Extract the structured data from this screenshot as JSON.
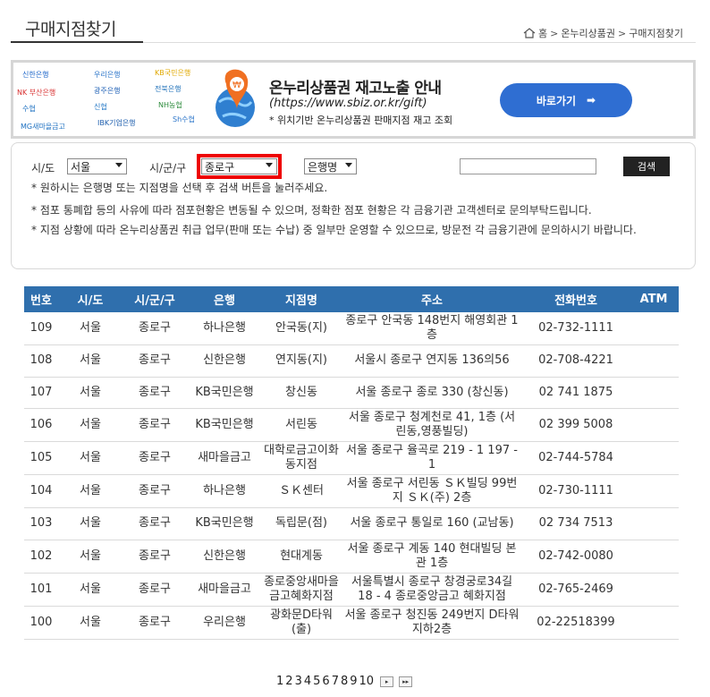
{
  "page": {
    "title": "구매지점찾기"
  },
  "breadcrumb": {
    "home": "홈",
    "level1": "온누리상품권",
    "level2": "구매지점찾기",
    "separator": ">"
  },
  "banner": {
    "title": "온누리상품권 재고노출 안내",
    "url": "(https://www.sbiz.or.kr/gift)",
    "description": "* 위치기반 온누리상품권 판매지점 재고 조회",
    "button_label": "바로가기",
    "button_arrow": "➡",
    "bank_logos": [
      "신한은행",
      "우리은행",
      "KB국민은행",
      "NK 부산은행",
      "광주은행",
      "전북은행",
      "수협",
      "신협",
      "NH농협",
      "MG새마을금고",
      "IBK기업은행",
      "Sh수협"
    ]
  },
  "search": {
    "sido_label": "시/도",
    "sido_value": "서울",
    "sigungu_label": "시/군/구",
    "sigungu_value": "종로구",
    "bank_select_value": "은행명",
    "keyword_value": "",
    "button_label": "검색",
    "notes": [
      "* 원하시는 은행명 또는 지점명을 선택 후 검색 버튼을 눌러주세요.",
      "* 점포 통폐합 등의 사유에 따라 점포현황은 변동될 수 있으며, 정확한 점포 현황은 각 금융기관 고객센터로 문의부탁드립니다.",
      "* 지점 상황에 따라 온누리상품권 취급 업무(판매 또는 수납) 중 일부만 운영할 수 있으므로, 방문전 각 금융기관에 문의하시기 바랍니다."
    ]
  },
  "table": {
    "headers": [
      "번호",
      "시/도",
      "시/군/구",
      "은행",
      "지점명",
      "주소",
      "전화번호",
      "ATM"
    ],
    "rows": [
      [
        "109",
        "서울",
        "종로구",
        "하나은행",
        "안국동(지)",
        "종로구 안국동 148번지 해영회관 1층",
        "02-732-1111",
        ""
      ],
      [
        "108",
        "서울",
        "종로구",
        "신한은행",
        "연지동(지)",
        "서울시 종로구 연지동 136의56",
        "02-708-4221",
        ""
      ],
      [
        "107",
        "서울",
        "종로구",
        "KB국민은행",
        "창신동",
        "서울 종로구 종로 330 (창신동)",
        "02 741 1875",
        ""
      ],
      [
        "106",
        "서울",
        "종로구",
        "KB국민은행",
        "서린동",
        "서울 종로구 청계천로 41, 1층 (서린동,영풍빌딩)",
        "02 399 5008",
        ""
      ],
      [
        "105",
        "서울",
        "종로구",
        "새마을금고",
        "대학로금고이화동지점",
        "서울 종로구 율곡로 219 - 1 197 - 1",
        "02-744-5784",
        ""
      ],
      [
        "104",
        "서울",
        "종로구",
        "하나은행",
        "ＳＫ센터",
        "서울 종로구 서린동 ＳＫ빌딩 99번지 ＳＫ(주) 2층",
        "02-730-1111",
        ""
      ],
      [
        "103",
        "서울",
        "종로구",
        "KB국민은행",
        "독립문(점)",
        "서울 종로구 통일로 160 (교남동)",
        "02 734 7513",
        ""
      ],
      [
        "102",
        "서울",
        "종로구",
        "신한은행",
        "현대계동",
        "서울 종로구 계동 140 현대빌딩 본관 1층",
        "02-742-0080",
        ""
      ],
      [
        "101",
        "서울",
        "종로구",
        "새마을금고",
        "종로중앙새마을금고혜화지점",
        "서울특별시 종로구 창경궁로34길 18 - 4 종로중앙금고 혜화지점",
        "02-765-2469",
        ""
      ],
      [
        "100",
        "서울",
        "종로구",
        "우리은행",
        "광화문D타워(출)",
        "서울 종로구 청진동 249번지 D타워 지하2층",
        "02-22518399",
        ""
      ]
    ]
  },
  "pagination": {
    "pages": [
      "1",
      "2",
      "3",
      "4",
      "5",
      "6",
      "7",
      "8",
      "9",
      "10"
    ],
    "next": "▸",
    "last": "▸▸"
  },
  "colors": {
    "header_bg": "#2f6fad",
    "button_blue": "#2f6ed2",
    "highlight": "#ee0000"
  }
}
